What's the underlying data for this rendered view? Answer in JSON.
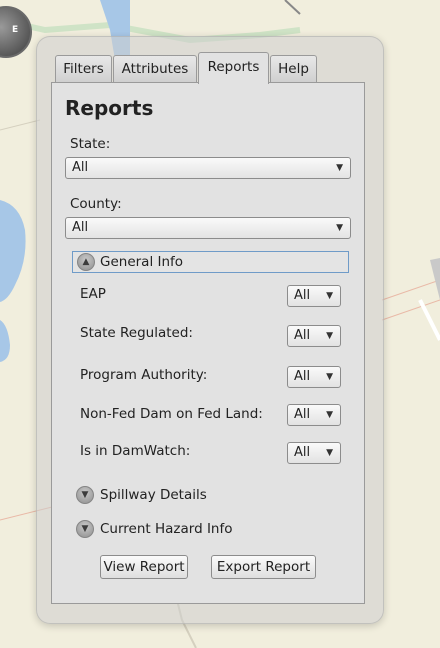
{
  "tabs": [
    {
      "label": "Filters"
    },
    {
      "label": "Attributes"
    },
    {
      "label": "Reports",
      "active": true
    },
    {
      "label": "Help"
    }
  ],
  "panel": {
    "title": "Reports"
  },
  "state": {
    "label": "State:",
    "value": "All"
  },
  "county": {
    "label": "County:",
    "value": "All"
  },
  "general_info": {
    "label": "General Info",
    "expanded": true,
    "fields": [
      {
        "label": "EAP",
        "value": "All"
      },
      {
        "label": "State Regulated:",
        "value": "All"
      },
      {
        "label": "Program Authority:",
        "value": "All"
      },
      {
        "label": "Non-Fed Dam on Fed Land:",
        "value": "All"
      },
      {
        "label": "Is in DamWatch:",
        "value": "All"
      }
    ]
  },
  "spillway": {
    "label": "Spillway Details",
    "expanded": false
  },
  "hazard": {
    "label": "Current Hazard Info",
    "expanded": false
  },
  "buttons": {
    "view": "View Report",
    "export": "Export Report"
  },
  "compass": {
    "label": "E"
  },
  "icons": {
    "expanded": "chevron-up-icon",
    "collapsed": "chevron-down-icon",
    "dropdown": "dropdown-arrow-icon"
  },
  "colors": {
    "panel_bg": "#e2e2e2",
    "focus_border": "#6f9bc8",
    "water": "#a7c7e7",
    "map_bg": "#f1eedd"
  }
}
